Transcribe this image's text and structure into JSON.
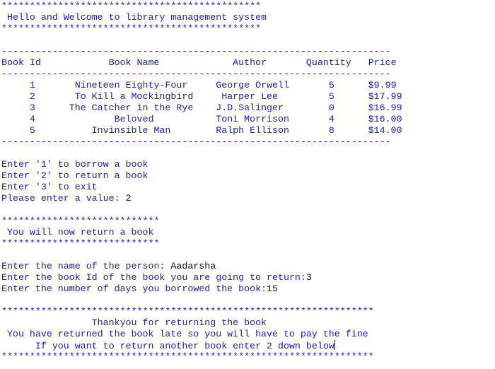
{
  "colors": {
    "console_text": "#1a1ad0",
    "user_input": "#111111",
    "background": "#ffffff"
  },
  "banner_top": "**********************************************",
  "welcome": " Hello and Welcome to library management system",
  "banner_bottom": "**********************************************",
  "table": {
    "rule": "---------------------------------------------------------------------",
    "headers": [
      "Book Id",
      "Book Name",
      "Author",
      "Quantity",
      "Price"
    ],
    "rows": [
      {
        "id": "1",
        "name": "Nineteen Eighty-Four",
        "author": "George Orwell",
        "quantity": "5",
        "price": "$9.99"
      },
      {
        "id": "2",
        "name": "To Kill a Mockingbird",
        "author": "Harper Lee",
        "quantity": "5",
        "price": "$17.99"
      },
      {
        "id": "3",
        "name": "The Catcher in the Rye",
        "author": "J.D.Salinger",
        "quantity": "0",
        "price": "$16.99"
      },
      {
        "id": "4",
        "name": "Beloved",
        "author": "Toni Morrison",
        "quantity": "4",
        "price": "$16.00"
      },
      {
        "id": "5",
        "name": "Invinsible Man",
        "author": "Ralph Ellison",
        "quantity": "8",
        "price": "$14.00"
      }
    ]
  },
  "menu": {
    "option1": "Enter '1' to borrow a book",
    "option2": "Enter '2' to return a book",
    "option3": "Enter '3' to exit",
    "prompt": "Please enter a value: ",
    "value": "2"
  },
  "return_banner": {
    "stars": "****************************",
    "message": " You will now return a book"
  },
  "return_form": {
    "name_prompt": "Enter the name of the person: ",
    "name_value": "Aadarsha",
    "id_prompt": "Enter the book Id of the book you are going to return:",
    "id_value": "3",
    "days_prompt": "Enter the number of days you borrowed the book:",
    "days_value": "15"
  },
  "final_banner": {
    "stars": "******************************************************************",
    "thanks": "                Thankyou for returning the book",
    "late": " You have returned the book late so you will have to pay the fine",
    "again": "      If you want to return another book enter 2 down below"
  }
}
